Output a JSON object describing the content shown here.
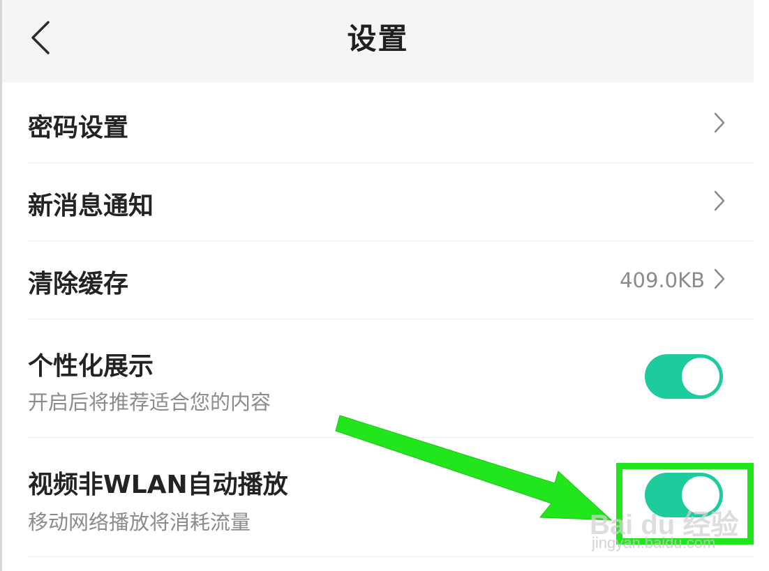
{
  "header": {
    "title": "设置"
  },
  "rows": [
    {
      "label": "密码设置"
    },
    {
      "label": "新消息通知"
    },
    {
      "label": "清除缓存",
      "value": "409.0KB"
    },
    {
      "label": "个性化展示",
      "subtitle": "开启后将推荐适合您的内容",
      "toggle_on": true
    },
    {
      "label": "视频非WLAN自动播放",
      "subtitle": "移动网络播放将消耗流量",
      "toggle_on": true
    }
  ],
  "watermark": {
    "logo": "Bai du 经验",
    "url": "jingyan.baidu.com"
  },
  "colors": {
    "toggle_on": "#1ecb9c",
    "annotation": "#22e61c",
    "header_bg": "#f5f5f5"
  },
  "icons": {
    "back": "chevron-left-icon",
    "row_arrow": "chevron-right-icon"
  }
}
